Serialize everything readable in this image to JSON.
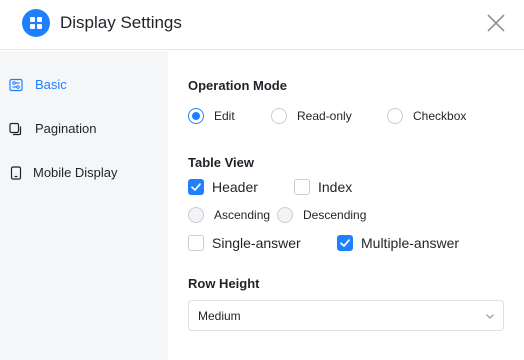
{
  "dialog": {
    "title": "Display Settings",
    "accent_color": "#1e80ff"
  },
  "sidebar": {
    "items": [
      {
        "label": "Basic",
        "icon": "basic-settings-icon",
        "active": true
      },
      {
        "label": "Pagination",
        "icon": "pagination-icon",
        "active": false
      },
      {
        "label": "Mobile Display",
        "icon": "mobile-icon",
        "active": false
      }
    ]
  },
  "operation_mode": {
    "title": "Operation Mode",
    "options": [
      {
        "label": "Edit",
        "checked": true
      },
      {
        "label": "Read-only",
        "checked": false
      },
      {
        "label": "Checkbox",
        "checked": false
      }
    ]
  },
  "table_view": {
    "title": "Table View",
    "header": {
      "label": "Header",
      "checked": true
    },
    "index": {
      "label": "Index",
      "checked": false
    },
    "ascending": {
      "label": "Ascending",
      "checked": false
    },
    "descending": {
      "label": "Descending",
      "checked": false
    },
    "single_answer": {
      "label": "Single-answer",
      "checked": false
    },
    "multiple_answer": {
      "label": "Multiple-answer",
      "checked": true
    }
  },
  "row_height": {
    "title": "Row Height",
    "value": "Medium"
  }
}
